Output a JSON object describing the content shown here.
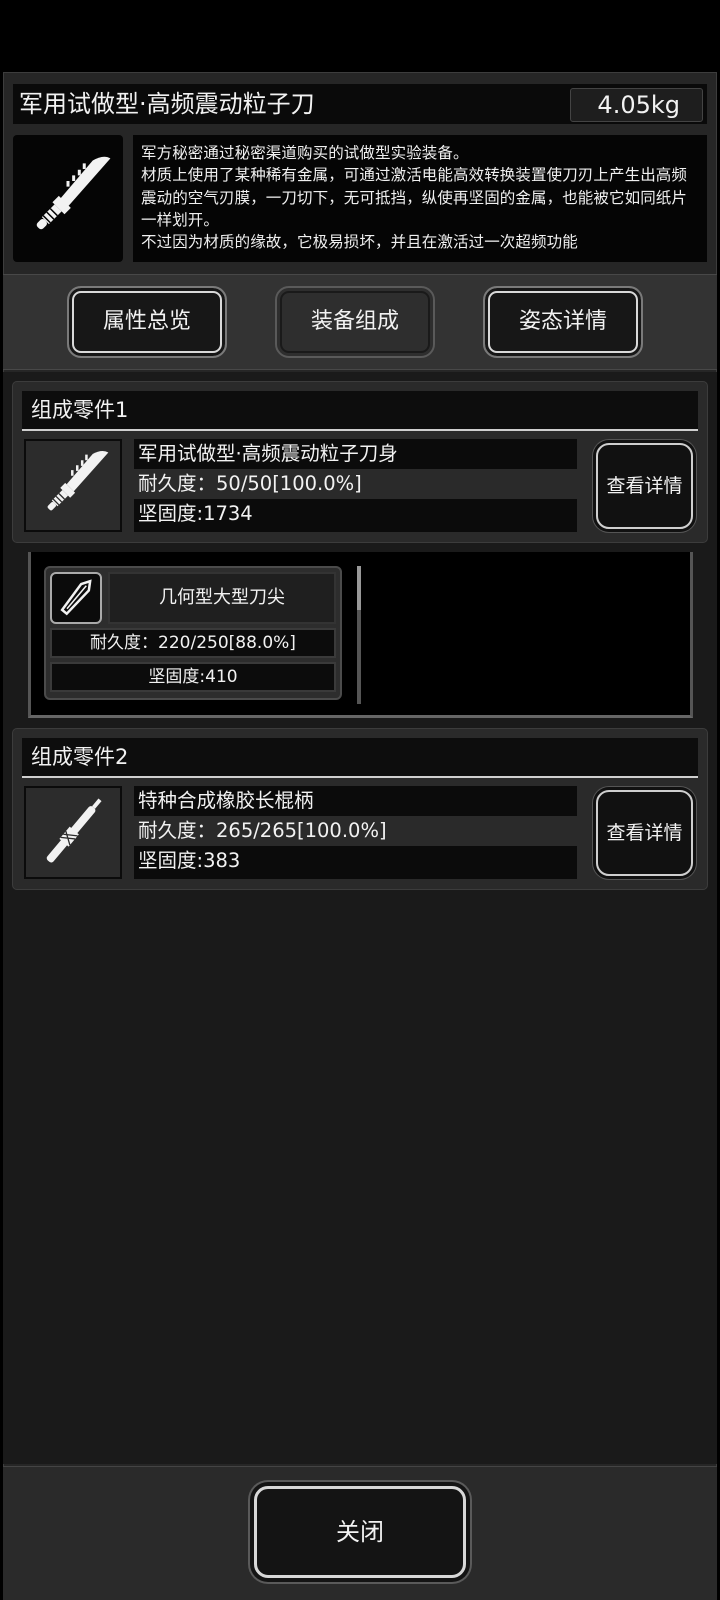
{
  "item": {
    "name": "军用试做型·高频震动粒子刀",
    "weight": "4.05kg",
    "description": "军方秘密通过秘密渠道购买的试做型实验装备。\n材质上使用了某种稀有金属，可通过激活电能高效转换装置使刀刃上产生出高频震动的空气刃膜，一刀切下，无可抵挡，纵使再坚固的金属，也能被它如同纸片一样划开。\n不过因为材质的缘故，它极易损坏，并且在激活过一次超频功能"
  },
  "tabs": [
    {
      "label": "属性总览"
    },
    {
      "label": "装备组成"
    },
    {
      "label": "姿态详情"
    }
  ],
  "parts": [
    {
      "header": "组成零件1",
      "name": "军用试做型·高频震动粒子刀身",
      "durability": "耐久度：50/50[100.0%]",
      "hardness": "坚固度:1734",
      "detail_label": "查看详情",
      "icon": "knife-blade-icon"
    },
    {
      "header": "组成零件2",
      "name": "特种合成橡胶长棍柄",
      "durability": "耐久度：265/265[100.0%]",
      "hardness": "坚固度:383",
      "detail_label": "查看详情",
      "icon": "rubber-handle-icon"
    }
  ],
  "subpart": {
    "name": "几何型大型刀尖",
    "durability": "耐久度：220/250[88.0%]",
    "hardness": "坚固度:410",
    "icon": "blade-tip-icon"
  },
  "close_label": "关闭",
  "colors": {
    "panel": "#262626",
    "header": "#0a0a0a",
    "accent": "#d9d9d9"
  }
}
